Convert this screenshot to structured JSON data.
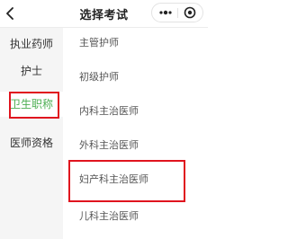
{
  "header": {
    "title": "选择考试",
    "back_icon": "back-chevron-icon",
    "capsule": {
      "more_icon": "more-dots-icon",
      "home_icon": "target-circle-icon"
    }
  },
  "sidebar": {
    "items": [
      {
        "label": "执业药师"
      },
      {
        "label": "护士"
      },
      {
        "label": "卫生职称",
        "selected": true
      },
      {
        "label": "医师资格"
      }
    ]
  },
  "main": {
    "items": [
      {
        "label": "主管护师"
      },
      {
        "label": "初级护师"
      },
      {
        "label": "内科主治医师"
      },
      {
        "label": "外科主治医师"
      },
      {
        "label": "妇产科主治医师",
        "highlighted": true
      },
      {
        "label": "儿科主治医师"
      }
    ]
  },
  "colors": {
    "accent_green": "#4cae52",
    "highlight_red": "#e0141e"
  }
}
